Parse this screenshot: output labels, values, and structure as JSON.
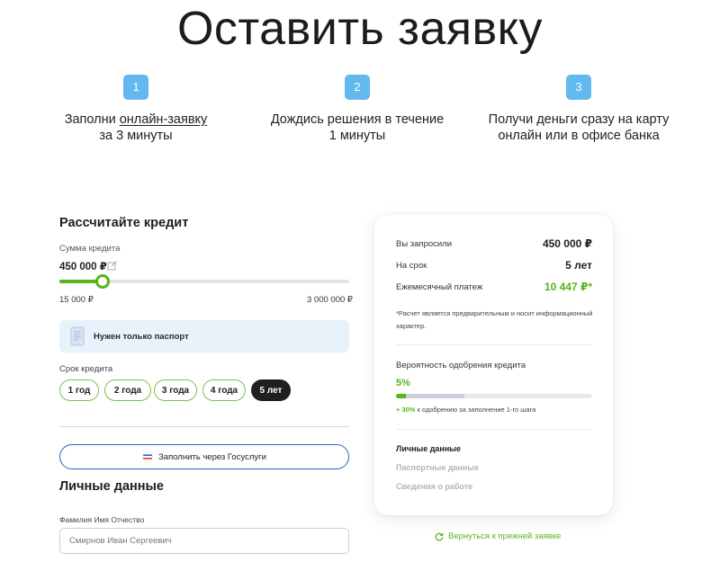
{
  "page": {
    "title": "Оставить заявку"
  },
  "steps": [
    {
      "number": "1",
      "line1_prefix": "Заполни ",
      "line1_link": "онлайн-заявку",
      "line2": "за 3 минуты"
    },
    {
      "number": "2",
      "line1": "Дождись решения в течение",
      "line2": "1 минуты"
    },
    {
      "number": "3",
      "line1": "Получи деньги сразу на карту",
      "line2": "онлайн или в офисе банка"
    }
  ],
  "calculator": {
    "title": "Рассчитайте кредит",
    "amount_label": "Сумма кредита",
    "amount_value": "450 000 ₽",
    "slider_fraction": 0.15,
    "min_label": "15 000 ₽",
    "max_label": "3 000 000 ₽",
    "passport_note": "Нужен только паспорт",
    "term_label": "Срок кредита",
    "terms": [
      "1 год",
      "2 года",
      "3 года",
      "4 года",
      "5 лет"
    ],
    "selected_term": "5 лет",
    "gosuslugi_button": "Заполнить через Госуслуги"
  },
  "personal": {
    "title": "Личные данные",
    "fio_label": "Фамилия Имя Отчество",
    "fio_placeholder": "Смирнов Иван Сергеевич"
  },
  "summary": {
    "requested_label": "Вы запросили",
    "requested_value": "450 000 ₽",
    "term_label": "На срок",
    "term_value": "5 лет",
    "payment_label": "Ежемесячный платеж",
    "payment_value": "10 447 ₽*",
    "note": "*Расчет является предварительным и носит информационный характер.",
    "probability_label": "Вероятность одобрения кредита",
    "probability_value": "5%",
    "probability_fraction": 0.05,
    "probability_next_fraction": 0.35,
    "bonus_strong": "+ 30%",
    "bonus_text": " к одобрению за заполнение 1-го шага",
    "form_steps": [
      {
        "label": "Личные данные",
        "active": true
      },
      {
        "label": "Паспортные данные",
        "active": false
      },
      {
        "label": "Сведения о работе",
        "active": false
      }
    ]
  },
  "return_link": "Вернуться к прежней заявке",
  "colors": {
    "accent_green": "#56b51c",
    "step_blue": "#63b8ee",
    "passport_bg": "#e8f2fb",
    "active_term_bg": "#1f1f1f",
    "gosuslugi_border": "#2b63c8",
    "inactive_step_text": "#b4b4b4"
  },
  "icons": {
    "edit": "edit-icon",
    "document": "document-icon",
    "gosuslugi": "gosuslugi-logo-icon",
    "refresh": "refresh-icon"
  }
}
